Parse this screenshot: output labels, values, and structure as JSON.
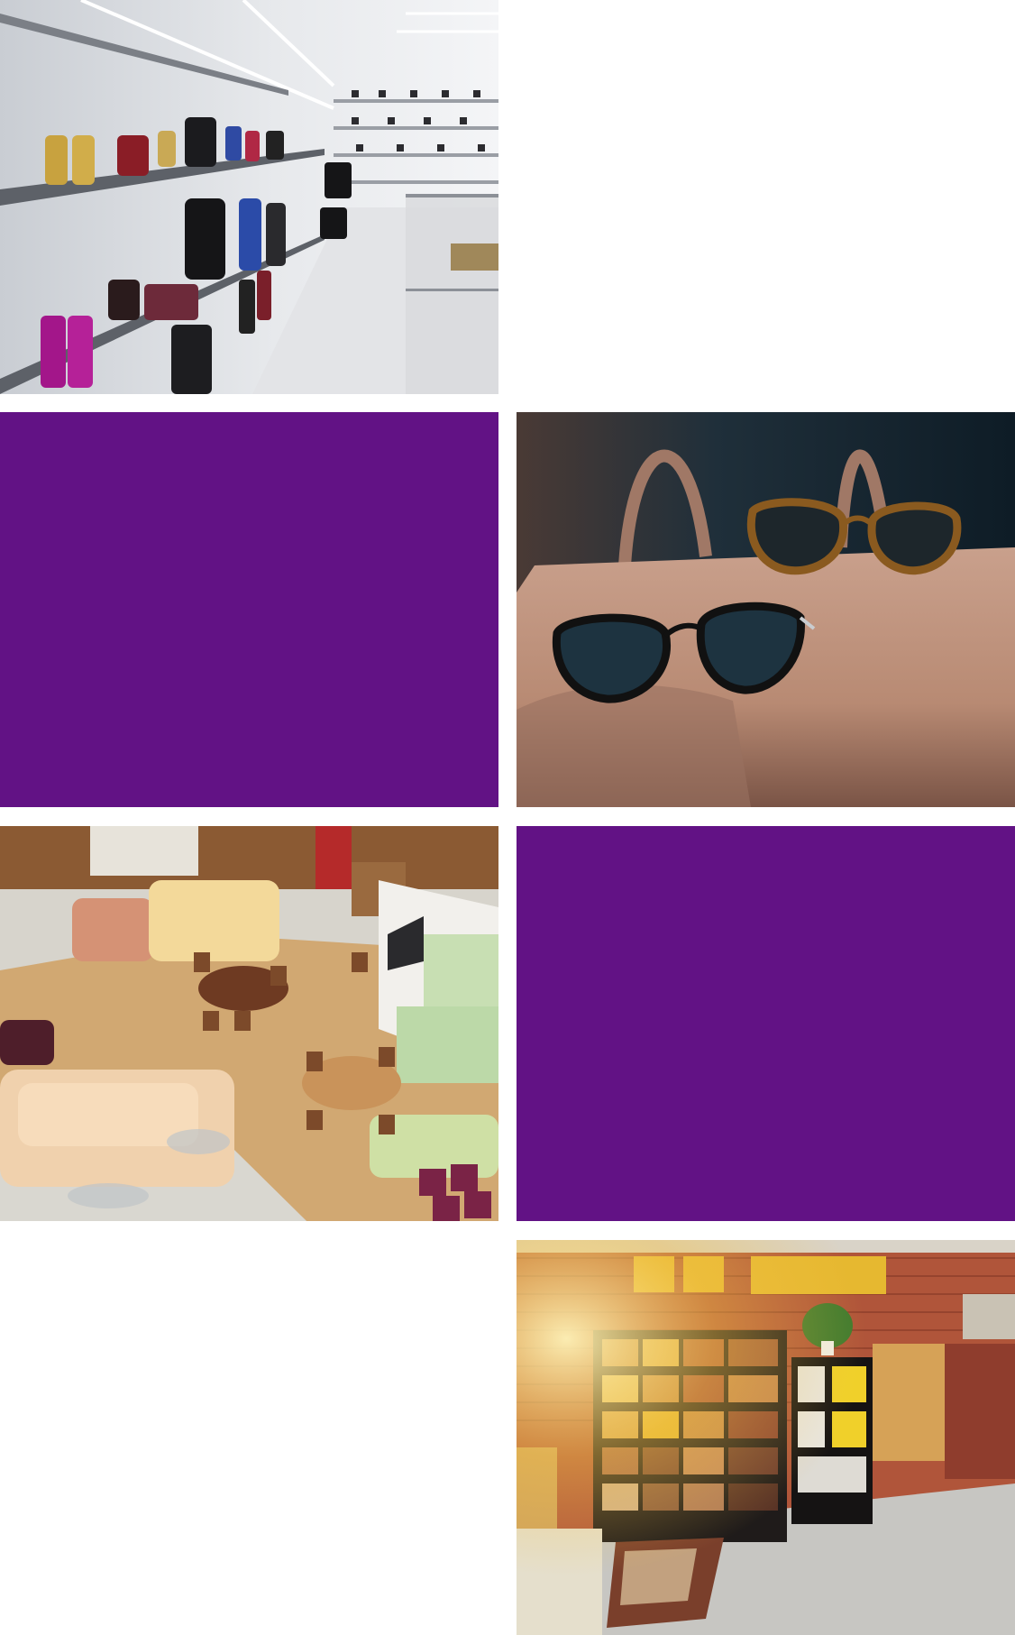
{
  "grid": {
    "accent_color": "#621285",
    "background_color": "#ffffff",
    "tiles": [
      {
        "kind": "photo",
        "subject": "luxury-shoe-and-handbag-store-shelves"
      },
      {
        "kind": "color-block"
      },
      {
        "kind": "photo",
        "subject": "sunglasses-on-leather-handbag"
      },
      {
        "kind": "photo",
        "subject": "furniture-showroom-overhead-view"
      },
      {
        "kind": "color-block"
      },
      {
        "kind": "photo",
        "subject": "brick-and-tile-material-showroom"
      }
    ]
  }
}
